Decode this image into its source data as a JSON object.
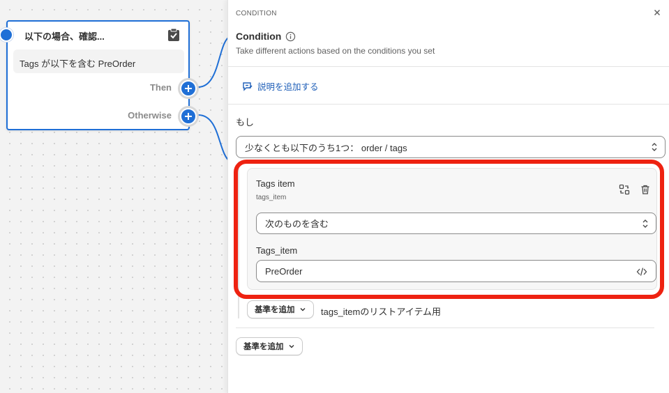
{
  "node": {
    "title": "以下の場合、確認...",
    "rule_text": "Tags が以下を含む PreOrder",
    "outputs": [
      "Then",
      "Otherwise"
    ],
    "icon": "clipboard-icon"
  },
  "panel": {
    "section_label": "CONDITION",
    "title": "Condition",
    "subtitle": "Take different actions based on the conditions you set",
    "add_description": "説明を追加する",
    "if_label": "もし",
    "main_select": "少なくとも以下のうち1つ：  order / tags",
    "criterion": {
      "title": "Tags item",
      "subtitle": "tags_item",
      "operator": "次のものを含む",
      "field_label": "Tags_item",
      "value": "PreOrder"
    },
    "inner_add_button": "基準を追加",
    "inner_add_note": "tags_itemのリストアイテム用",
    "outer_add_button": "基準を追加"
  },
  "colors": {
    "accent": "#1f6fd6",
    "highlight": "#ee2211",
    "link": "#1f5fb8"
  }
}
